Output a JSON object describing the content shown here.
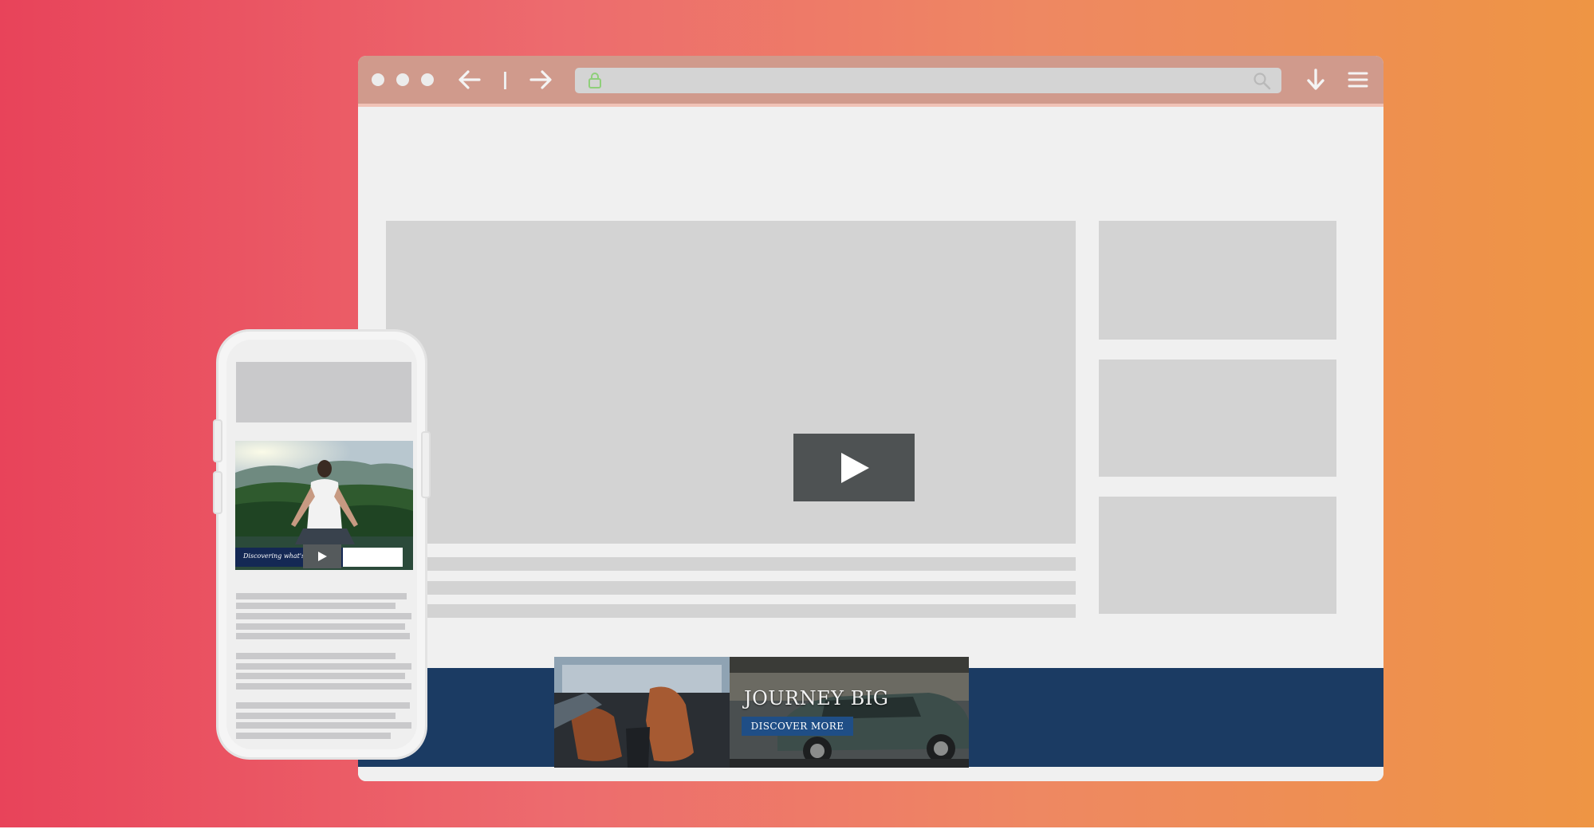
{
  "browser": {
    "toolbar": {
      "back_icon": "arrow-left-icon",
      "forward_icon": "arrow-right-icon",
      "download_icon": "download-arrow-icon",
      "menu_icon": "hamburger-menu-icon",
      "lock_icon": "lock-icon",
      "search_icon": "search-icon",
      "url": ""
    },
    "ad_banner": {
      "headline": "JOURNEY BIG",
      "cta_label": "DISCOVER MORE"
    }
  },
  "phone": {
    "video_caption": "Discovering what's po",
    "play_icon": "play-icon"
  },
  "colors": {
    "background_start": "#e8435a",
    "background_end": "#ee9544",
    "ad_band": "#1b3b63",
    "cta_button": "#1f4e86",
    "play_button": "#4e5253",
    "placeholder": "#d3d3d3"
  }
}
